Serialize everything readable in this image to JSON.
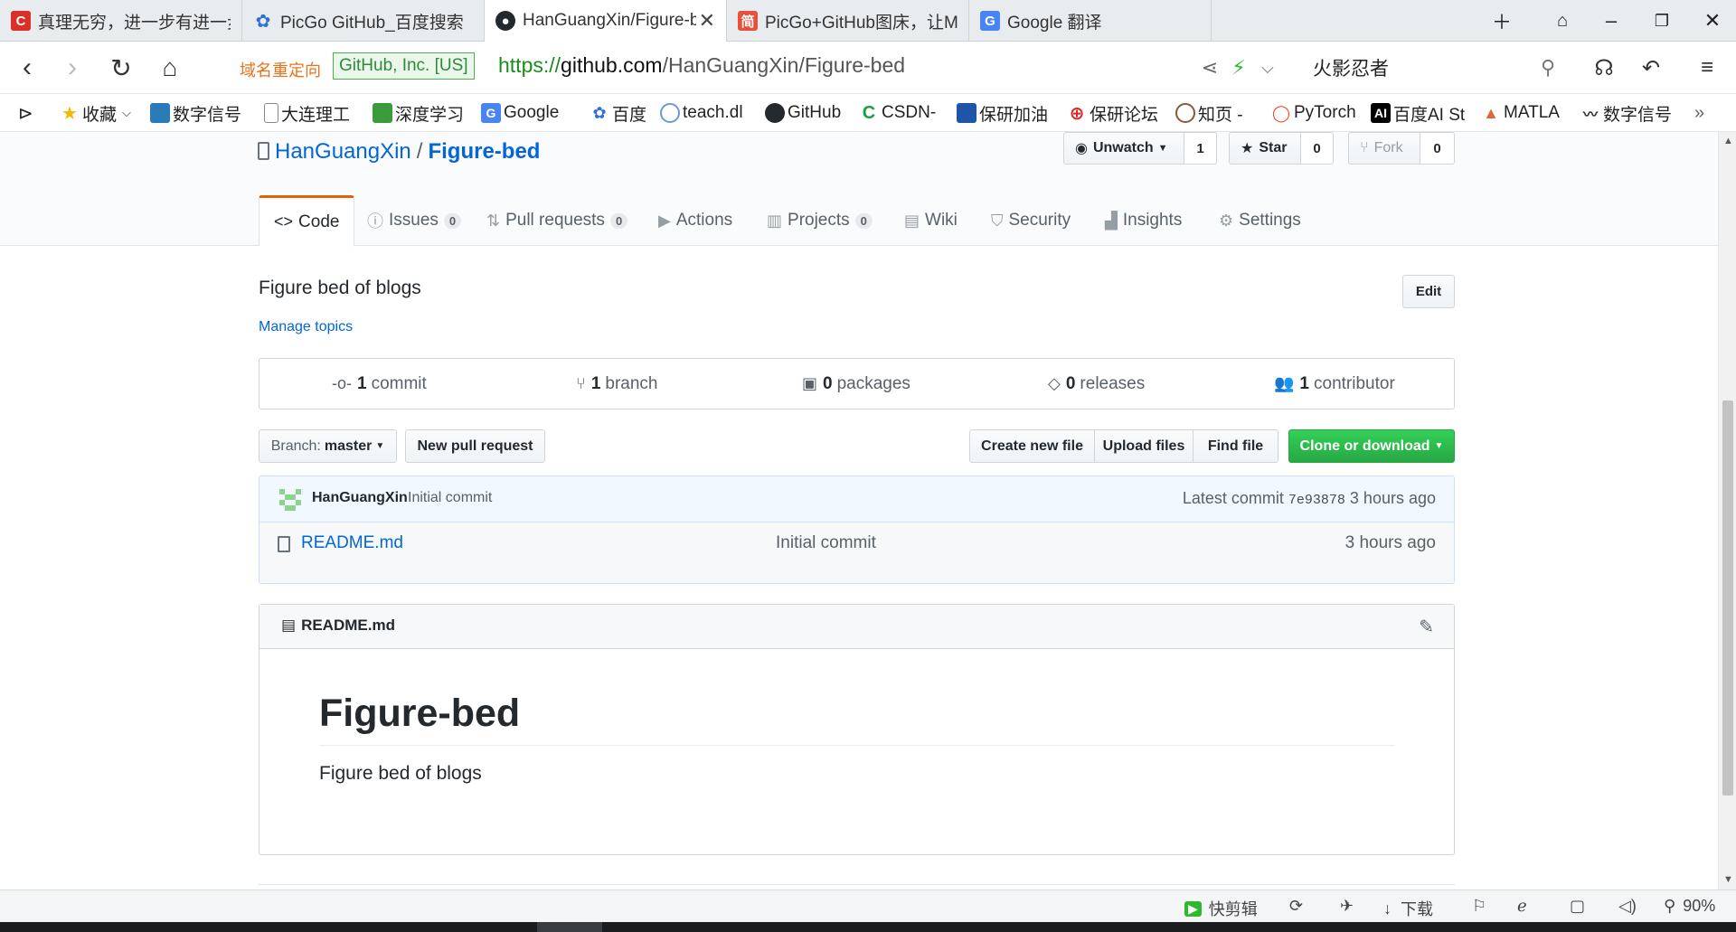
{
  "tabs": [
    {
      "title": "真理无穷，进一步有进一步的欢",
      "icon": "csdn-icon",
      "color": "#d9302a"
    },
    {
      "title": "PicGo GitHub_百度搜索",
      "icon": "baidu-icon",
      "color": "#2f6fd8"
    },
    {
      "title": "HanGuangXin/Figure-bed: Fi",
      "icon": "github-icon",
      "color": "#24292e"
    },
    {
      "title": "PicGo+GitHub图床，让Mark",
      "icon": "jianshu-icon",
      "color": "#e8503a"
    },
    {
      "title": "Google 翻译",
      "icon": "google-translate-icon",
      "color": "#4a84f0"
    }
  ],
  "address": {
    "redirect_label": "域名重定向",
    "cert_label": "GitHub, Inc. [US]",
    "url_proto": "https://",
    "url_host": "github.com",
    "url_path": "/HanGuangXin/Figure-bed",
    "search_text": "火影忍者"
  },
  "bookmarks": [
    "收藏",
    "数字信号",
    "大连理工",
    "深度学习",
    "Google",
    "百度",
    "teach.dl",
    "GitHub",
    "CSDN-",
    "保研加油",
    "保研论坛",
    "知页 -",
    "PyTorch",
    "百度AI St",
    "MATLA",
    "数字信号"
  ],
  "repo": {
    "owner": "HanGuangXin",
    "separator": "/",
    "name": "Figure-bed",
    "unwatch_label": "Unwatch",
    "watch_count": "1",
    "star_label": "Star",
    "star_count": "0",
    "fork_label": "Fork",
    "fork_count": "0"
  },
  "repo_tabs": [
    {
      "label": "Code",
      "count": ""
    },
    {
      "label": "Issues",
      "count": "0"
    },
    {
      "label": "Pull requests",
      "count": "0"
    },
    {
      "label": "Actions",
      "count": ""
    },
    {
      "label": "Projects",
      "count": "0"
    },
    {
      "label": "Wiki",
      "count": ""
    },
    {
      "label": "Security",
      "count": ""
    },
    {
      "label": "Insights",
      "count": ""
    },
    {
      "label": "Settings",
      "count": ""
    }
  ],
  "about": {
    "description": "Figure bed of blogs",
    "manage_topics": "Manage topics",
    "edit_label": "Edit"
  },
  "summary": {
    "commits_num": "1",
    "commits_label": "commit",
    "branches_num": "1",
    "branches_label": "branch",
    "packages_num": "0",
    "packages_label": "packages",
    "releases_num": "0",
    "releases_label": "releases",
    "contributors_num": "1",
    "contributors_label": "contributor"
  },
  "toolbar": {
    "branch_prefix": "Branch:",
    "branch_name": "master",
    "new_pr": "New pull request",
    "create_file": "Create new file",
    "upload_files": "Upload files",
    "find_file": "Find file",
    "clone": "Clone or download"
  },
  "commit": {
    "author": "HanGuangXin",
    "message": "Initial commit",
    "latest_label": "Latest commit",
    "sha": "7e93878",
    "age": "3 hours ago"
  },
  "files": [
    {
      "name": "README.md",
      "message": "Initial commit",
      "age": "3 hours ago"
    }
  ],
  "readme": {
    "file_label": "README.md",
    "heading": "Figure-bed",
    "body": "Figure bed of blogs"
  },
  "status": {
    "kuaijianji": "快剪辑",
    "download": "下载",
    "zoom": "90%"
  }
}
